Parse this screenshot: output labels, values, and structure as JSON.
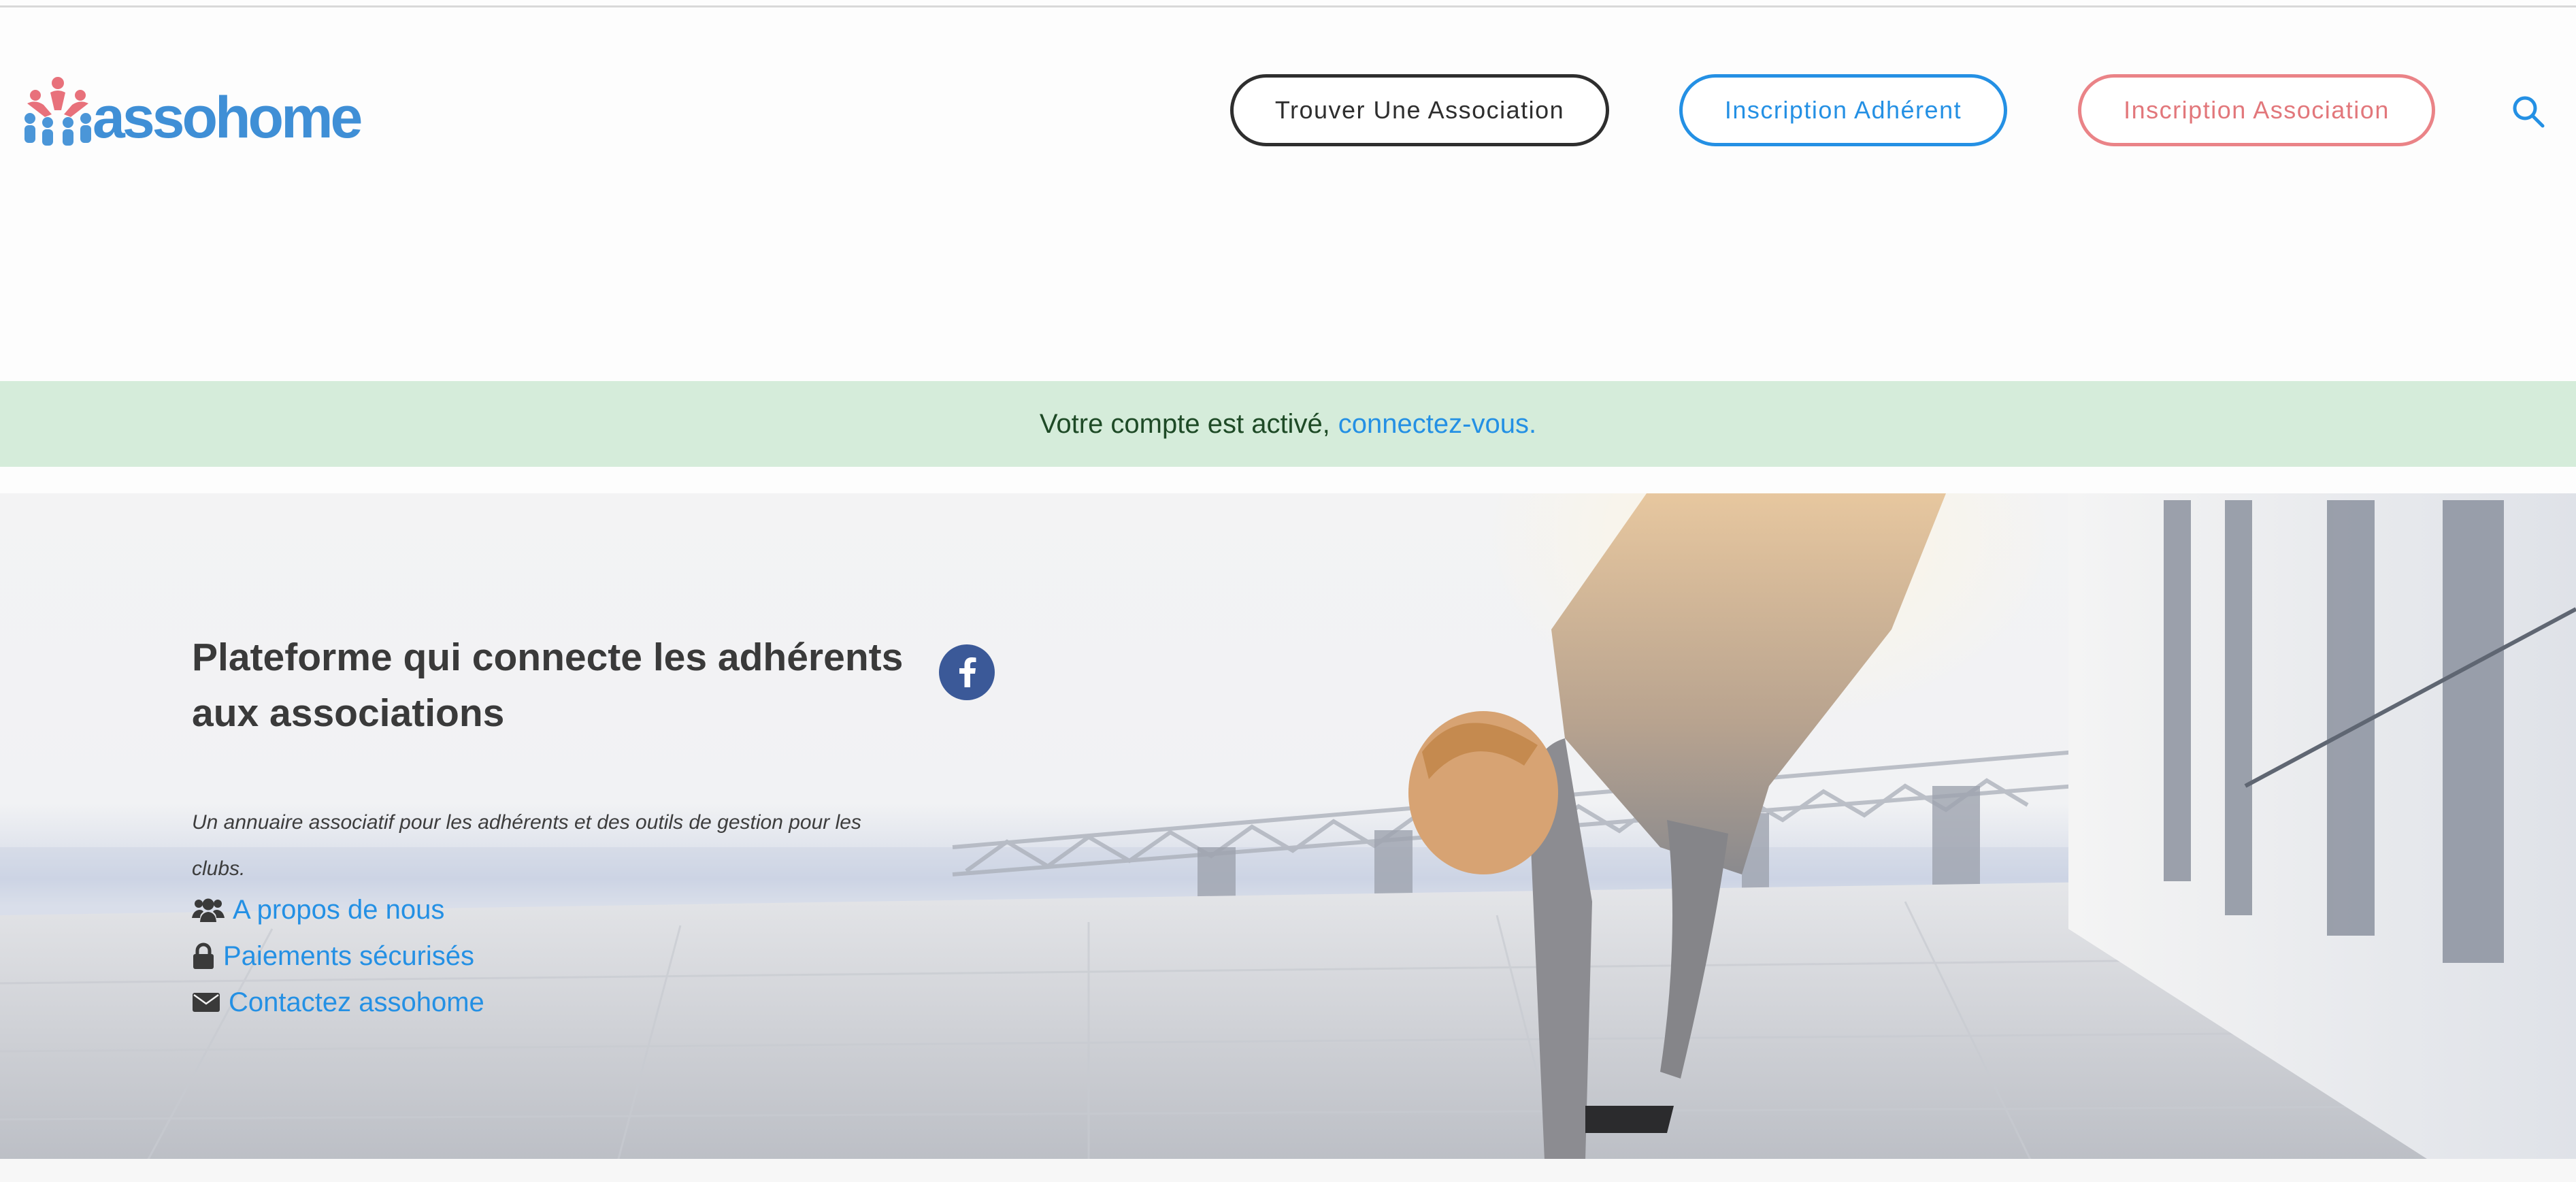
{
  "header": {
    "logo_text": "assohome",
    "nav": {
      "find_label": "Trouver Une Association",
      "member_label": "Inscription Adhérent",
      "assoc_label": "Inscription Association"
    },
    "search_icon": "search-icon"
  },
  "alert": {
    "text": "Votre compte est activé,",
    "link": "connectez-vous."
  },
  "hero": {
    "title": "Plateforme qui connecte les adhérents aux associations",
    "subtitle": "Un annuaire associatif pour les adhérents et des outils de gestion pour les clubs.",
    "links": [
      {
        "icon": "users-icon",
        "label": "A propos de nous"
      },
      {
        "icon": "lock-icon",
        "label": "Paiements sécurisés"
      },
      {
        "icon": "envelope-icon",
        "label": "Contactez assohome"
      }
    ],
    "social_icon": "facebook-icon"
  },
  "colors": {
    "brand_blue": "#2490e4",
    "brand_pink": "#ea8387",
    "alert_bg": "#d5ecda",
    "facebook": "#3b5998"
  }
}
